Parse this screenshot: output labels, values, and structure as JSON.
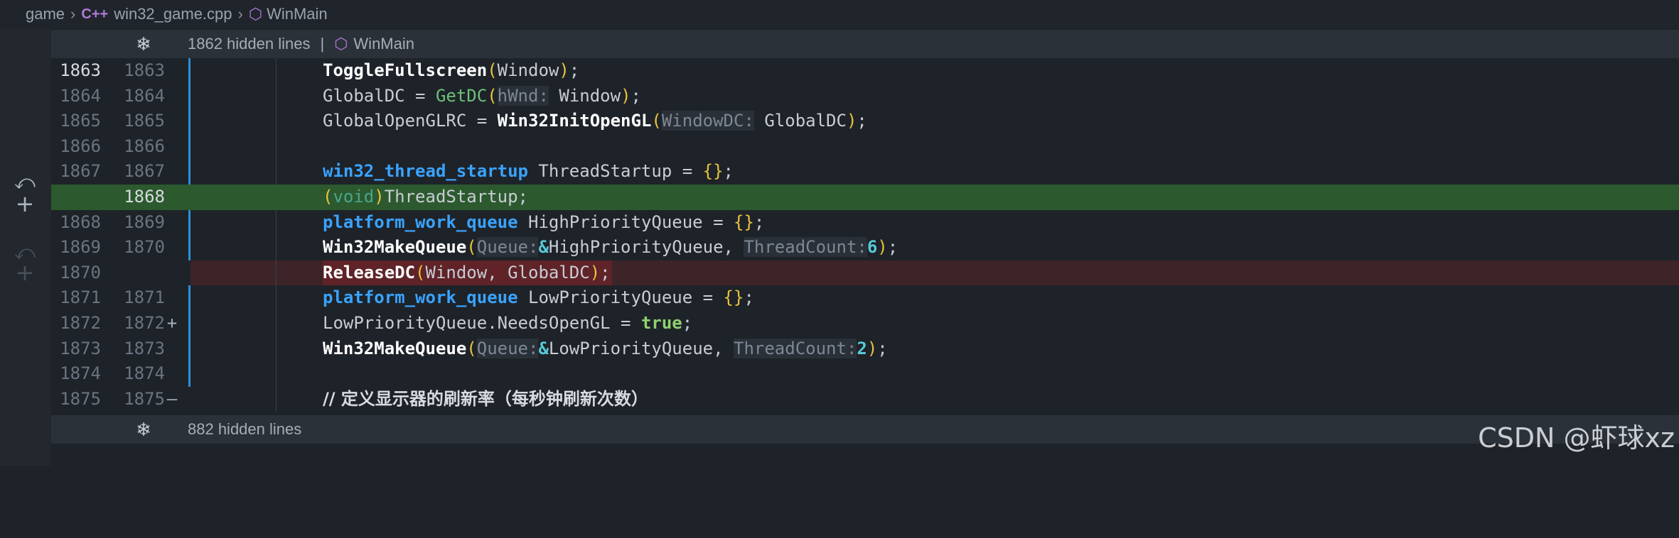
{
  "breadcrumb": {
    "items": [
      "game",
      "win32_game.cpp",
      "WinMain"
    ],
    "cpp_icon": "C++",
    "cube_icon": "cube-icon"
  },
  "fold_top": {
    "text": "1862 hidden lines",
    "sep": "|",
    "symbol": "WinMain"
  },
  "fold_bottom": {
    "text": "882 hidden lines"
  },
  "lines": [
    {
      "old": "1863",
      "new": "1863"
    },
    {
      "old": "1864",
      "new": "1864"
    },
    {
      "old": "1865",
      "new": "1865"
    },
    {
      "old": "1866",
      "new": "1866"
    },
    {
      "old": "1867",
      "new": "1867"
    },
    {
      "old": "",
      "new": "1868",
      "mark": "+"
    },
    {
      "old": "1868",
      "new": "1869"
    },
    {
      "old": "1869",
      "new": "1870"
    },
    {
      "old": "1870",
      "new": "",
      "mark": "—"
    },
    {
      "old": "1871",
      "new": "1871"
    },
    {
      "old": "1872",
      "new": "1872"
    },
    {
      "old": "1873",
      "new": "1873"
    },
    {
      "old": "1874",
      "new": "1874"
    },
    {
      "old": "1875",
      "new": "1875"
    }
  ],
  "code": {
    "l1": {
      "fn": "ToggleFullscreen",
      "arg": "Window",
      "end": ";"
    },
    "l2": {
      "lhs": "GlobalDC",
      "eq": " = ",
      "fn": "GetDC",
      "hint": "hWnd:",
      "arg": "Window",
      "end": ";"
    },
    "l3": {
      "lhs": "GlobalOpenGLRC",
      "eq": " = ",
      "fn": "Win32InitOpenGL",
      "hint": "WindowDC:",
      "arg": "GlobalDC",
      "end": ";"
    },
    "l5": {
      "type": "win32_thread_startup",
      "name": " ThreadStartup",
      "eq": " = ",
      "init": "{}",
      "end": ";"
    },
    "l6": {
      "cast": "void",
      "name": "ThreadStartup",
      "end": ";"
    },
    "l7": {
      "type": "platform_work_queue",
      "name": " HighPriorityQueue",
      "eq": " = ",
      "init": "{}",
      "end": ";"
    },
    "l8": {
      "fn": "Win32MakeQueue",
      "hint1": "Queue:",
      "amp": "&",
      "arg1": "HighPriorityQueue",
      "comma": ", ",
      "hint2": "ThreadCount:",
      "num": "6",
      "end": ";"
    },
    "l9": {
      "fn": "ReleaseDC",
      "args": "Window, GlobalDC",
      "end": ";"
    },
    "l10": {
      "type": "platform_work_queue",
      "name": " LowPriorityQueue",
      "eq": " = ",
      "init": "{}",
      "end": ";"
    },
    "l11": {
      "lhs": "LowPriorityQueue.NeedsOpenGL",
      "eq": " = ",
      "val": "true",
      "end": ";"
    },
    "l12": {
      "fn": "Win32MakeQueue",
      "hint1": "Queue:",
      "amp": "&",
      "arg1": "LowPriorityQueue",
      "comma": ", ",
      "hint2": "ThreadCount:",
      "num": "2",
      "end": ";"
    },
    "l14": {
      "comment": "// 定义显示器的刷新率（每秒钟刷新次数）"
    }
  },
  "watermark": "CSDN @虾球xz",
  "colors": {
    "added": "#2c5a2e",
    "removed": "#5a2227",
    "accent": "#2d8fd8"
  }
}
